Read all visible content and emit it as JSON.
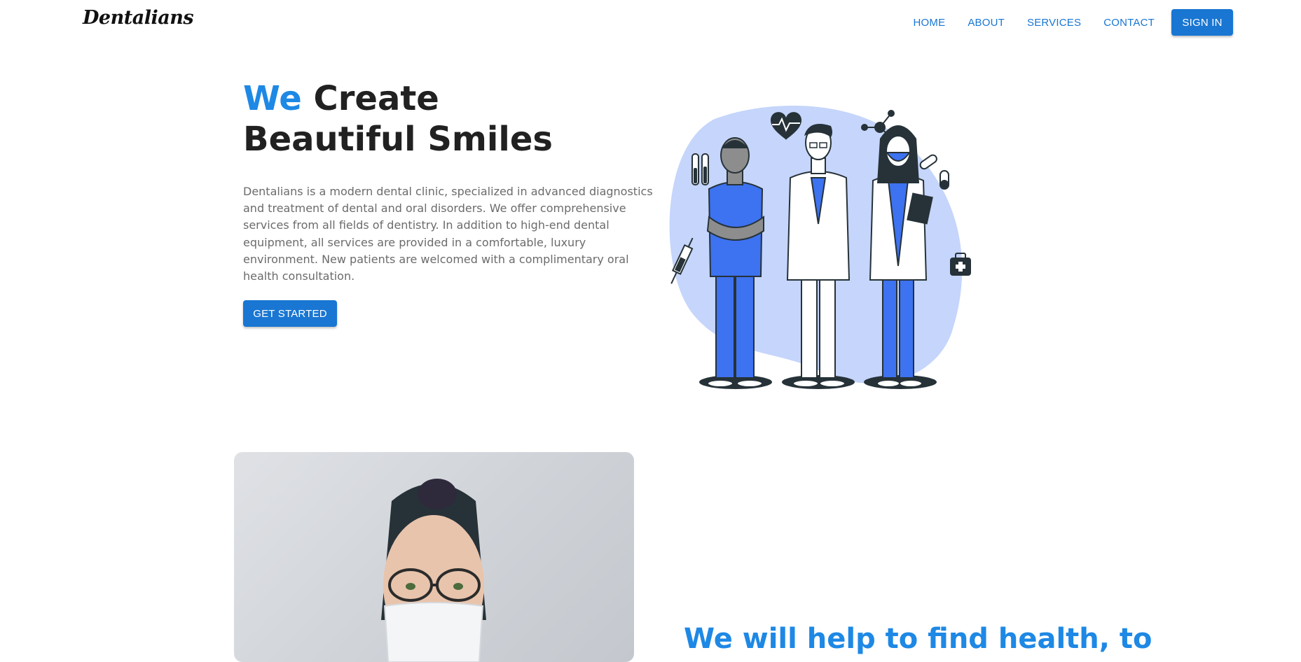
{
  "brand": {
    "name": "Dentalians"
  },
  "nav": {
    "links": [
      "HOME",
      "ABOUT",
      "SERVICES",
      "CONTACT"
    ],
    "signin_label": "SIGN IN"
  },
  "hero": {
    "title_accent": "We",
    "title_rest": "Create Beautiful Smiles",
    "description": "Dentalians is a modern dental clinic, specialized in advanced diagnostics and treatment of dental and oral disorders. We offer comprehensive services from all fields of dentistry. In addition to high-end dental equipment, all services are provided in a comfortable, luxury environment. New patients are welcomed with a complimentary oral health consultation.",
    "cta_label": "GET STARTED",
    "illustration": "medical-team-illustration"
  },
  "section2": {
    "photo": "masked-woman-photo",
    "heading": "We will help to find health, to"
  },
  "colors": {
    "primary": "#1976d2",
    "accent": "#1e88e5",
    "illustration_blob": "#c5d5fb",
    "scrubs": "#3d72f0",
    "dark": "#263238"
  }
}
